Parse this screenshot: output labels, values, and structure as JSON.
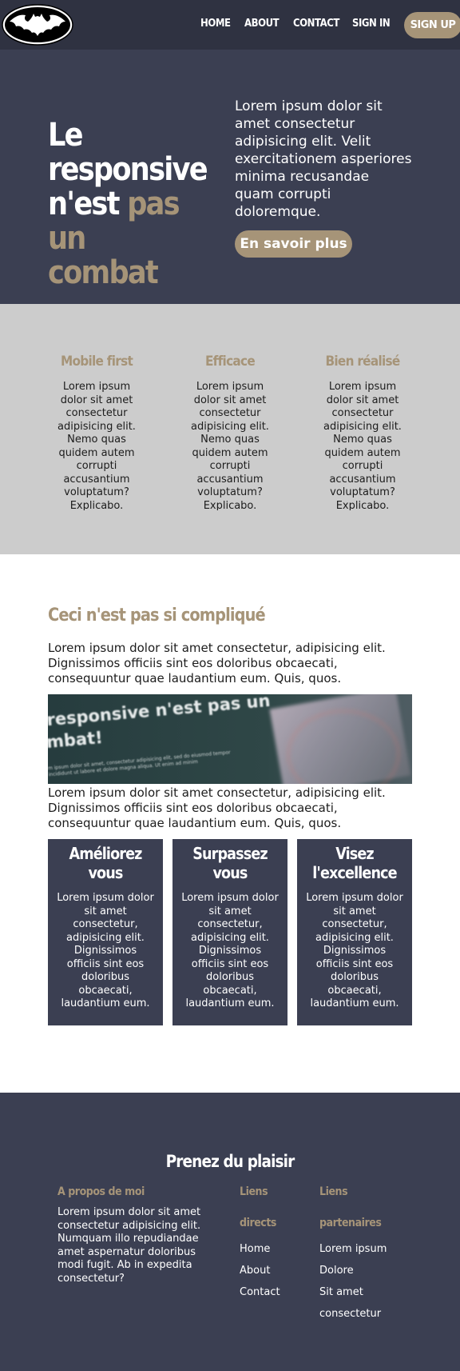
{
  "nav": {
    "links": [
      "HOME",
      "ABOUT",
      "CONTACT",
      "SIGN IN"
    ],
    "signup": "SIGN UP",
    "logo_icon": "batman-logo-icon"
  },
  "hero": {
    "title_line1": "Le",
    "title_line2": "responsive",
    "title_line3_white": "n'est",
    "title_line3_accent": "pas un",
    "title_line4_accent": "combat",
    "text": "Lorem ipsum dolor sit amet consectetur adipisicing elit. Velit exercitationem asperiores minima recusandae quam corrupti doloremque.",
    "button": "En savoir plus"
  },
  "features": [
    {
      "title": "Mobile first",
      "text": "Lorem ipsum dolor sit amet consectetur adipisicing elit. Nemo quas quidem autem corrupti accusantium voluptatum? Explicabo."
    },
    {
      "title": "Efficace",
      "text": "Lorem ipsum dolor sit amet consectetur adipisicing elit. Nemo quas quidem autem corrupti accusantium voluptatum? Explicabo."
    },
    {
      "title": "Bien réalisé",
      "text": "Lorem ipsum dolor sit amet consectetur adipisicing elit. Nemo quas quidem autem corrupti accusantium voluptatum? Explicabo."
    }
  ],
  "section": {
    "title": "Ceci n'est pas si compliqué",
    "paragraph1": "Lorem ipsum dolor sit amet consectetur, adipisicing elit. Dignissimos officiis sint eos doloribus obcaecati, consequuntur quae laudantium eum. Quis, quos.",
    "banner_line1": "responsive n'est pas un",
    "banner_line2": "mbat!",
    "banner_small": "m ipsum dolor sit amet, consectetur adipisicing elit, sed do eiusmod tempor incididunt ut labore et dolore magna aliqua. Ut enim ad minim",
    "paragraph2": "Lorem ipsum dolor sit amet consectetur, adipisicing elit. Dignissimos officiis sint eos doloribus obcaecati, consequuntur quae laudantium eum. Quis, quos."
  },
  "cards": [
    {
      "title_top": "Améliorez",
      "title_bottom": "vous",
      "text": "Lorem ipsum dolor sit amet consectetur, adipisicing elit. Dignissimos officiis sint eos doloribus obcaecati, laudantium eum."
    },
    {
      "title_top": "Surpassez",
      "title_bottom": "vous",
      "text": "Lorem ipsum dolor sit amet consectetur, adipisicing elit. Dignissimos officiis sint eos doloribus obcaecati, laudantium eum."
    },
    {
      "title_top": "Visez",
      "title_bottom": "l'excellence",
      "text": "Lorem ipsum dolor sit amet consectetur, adipisicing elit. Dignissimos officiis sint eos doloribus obcaecati, laudantium eum."
    }
  ],
  "footer": {
    "title": "Prenez du plaisir",
    "about_heading": "A propos de moi",
    "about_text": "Lorem ipsum dolor sit amet consectetur adipisicing elit. Numquam illo repudiandae amet aspernatur doloribus modi fugit. Ab in expedita consectetur?",
    "direct_heading_1": "Liens",
    "direct_heading_2": "directs",
    "direct_links": [
      "Home",
      "About",
      "Contact"
    ],
    "partner_heading_1": "Liens",
    "partner_heading_2": "partenaires",
    "partner_links": [
      "Lorem ipsum",
      "Dolore",
      "Sit amet",
      "consectetur"
    ]
  },
  "colors": {
    "nav_bg": "#2f3241",
    "dark_bg": "#3b3f52",
    "accent": "#a69478",
    "gray_bg": "#cccccc"
  }
}
